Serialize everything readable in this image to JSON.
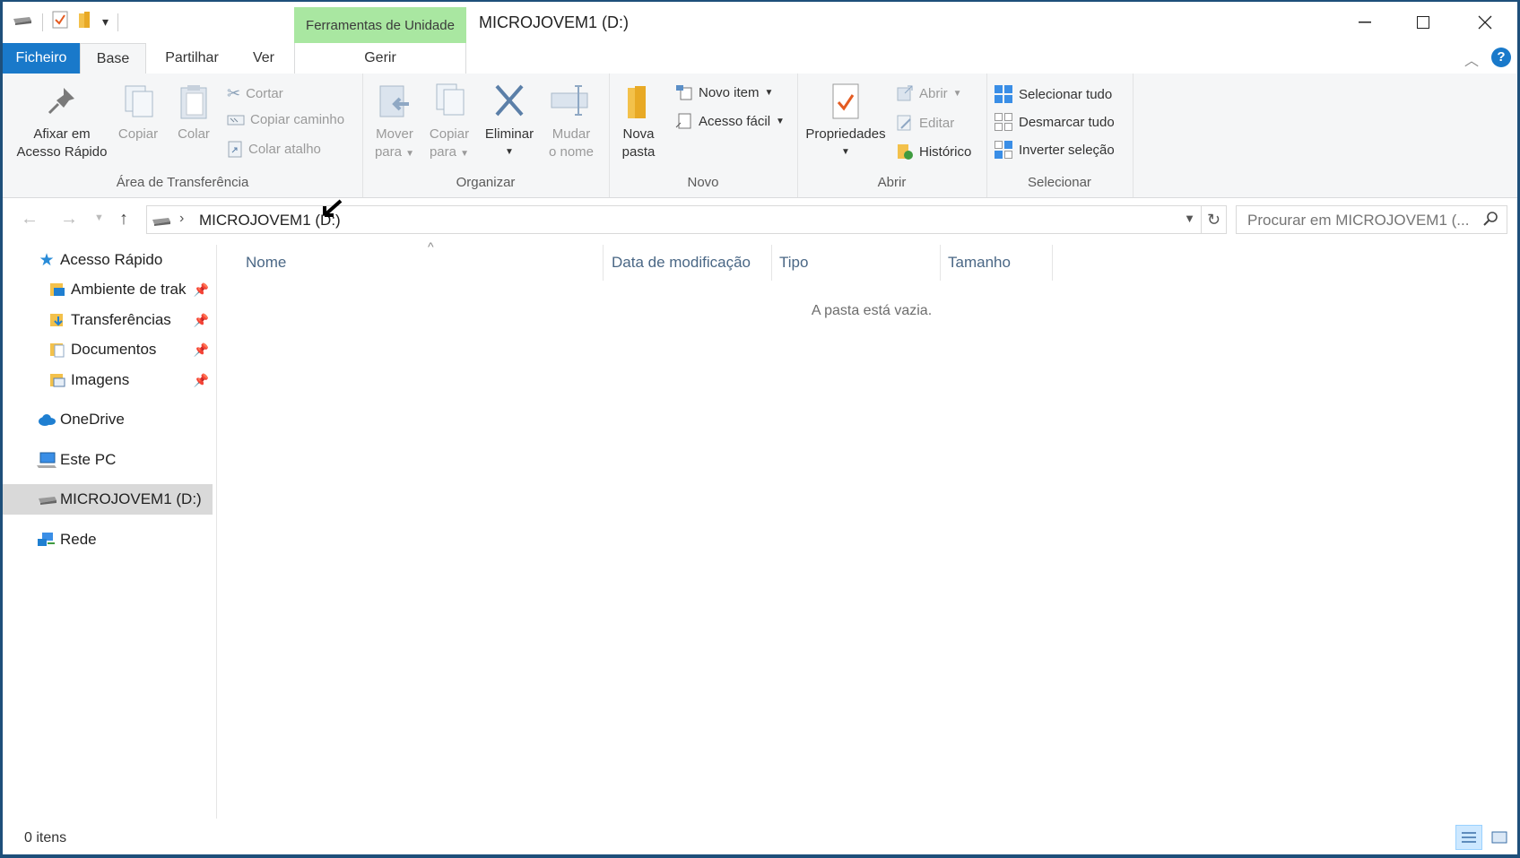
{
  "window": {
    "title": "MICROJOVEM1 (D:)",
    "context_tab": "Ferramentas de Unidade",
    "minimize": "—",
    "maximize": "☐",
    "close": "✕"
  },
  "tabs": [
    "Ficheiro",
    "Base",
    "Partilhar",
    "Ver",
    "Gerir"
  ],
  "ribbon": {
    "clipboard": {
      "label": "Área de Transferência",
      "pin_l1": "Afixar em",
      "pin_l2": "Acesso Rápido",
      "copy": "Copiar",
      "paste": "Colar",
      "cut": "Cortar",
      "copy_path": "Copiar caminho",
      "paste_shortcut": "Colar atalho"
    },
    "organize": {
      "label": "Organizar",
      "move_l1": "Mover",
      "move_l2": "para",
      "copyto_l1": "Copiar",
      "copyto_l2": "para",
      "delete": "Eliminar",
      "rename_l1": "Mudar",
      "rename_l2": "o nome"
    },
    "new": {
      "label": "Novo",
      "folder_l1": "Nova",
      "folder_l2": "pasta",
      "new_item": "Novo item",
      "easy_access": "Acesso fácil"
    },
    "open": {
      "label": "Abrir",
      "properties": "Propriedades",
      "open": "Abrir",
      "edit": "Editar",
      "history": "Histórico"
    },
    "select": {
      "label": "Selecionar",
      "select_all": "Selecionar tudo",
      "select_none": "Desmarcar tudo",
      "invert": "Inverter seleção"
    }
  },
  "address": {
    "path": "MICROJOVEM1 (D:)",
    "search_placeholder": "Procurar em MICROJOVEM1 (..."
  },
  "nav": {
    "quick_access": "Acesso Rápido",
    "desktop": "Ambiente de trak",
    "downloads": "Transferências",
    "documents": "Documentos",
    "pictures": "Imagens",
    "onedrive": "OneDrive",
    "this_pc": "Este PC",
    "drive": "MICROJOVEM1 (D:)",
    "network": "Rede"
  },
  "columns": [
    "Nome",
    "Data de modificação",
    "Tipo",
    "Tamanho"
  ],
  "empty_message": "A pasta está vazia.",
  "status": "0 itens",
  "colors": {
    "accent": "#1979ca",
    "context_tab": "#a9e7a1",
    "selected": "#d9d9d9"
  }
}
